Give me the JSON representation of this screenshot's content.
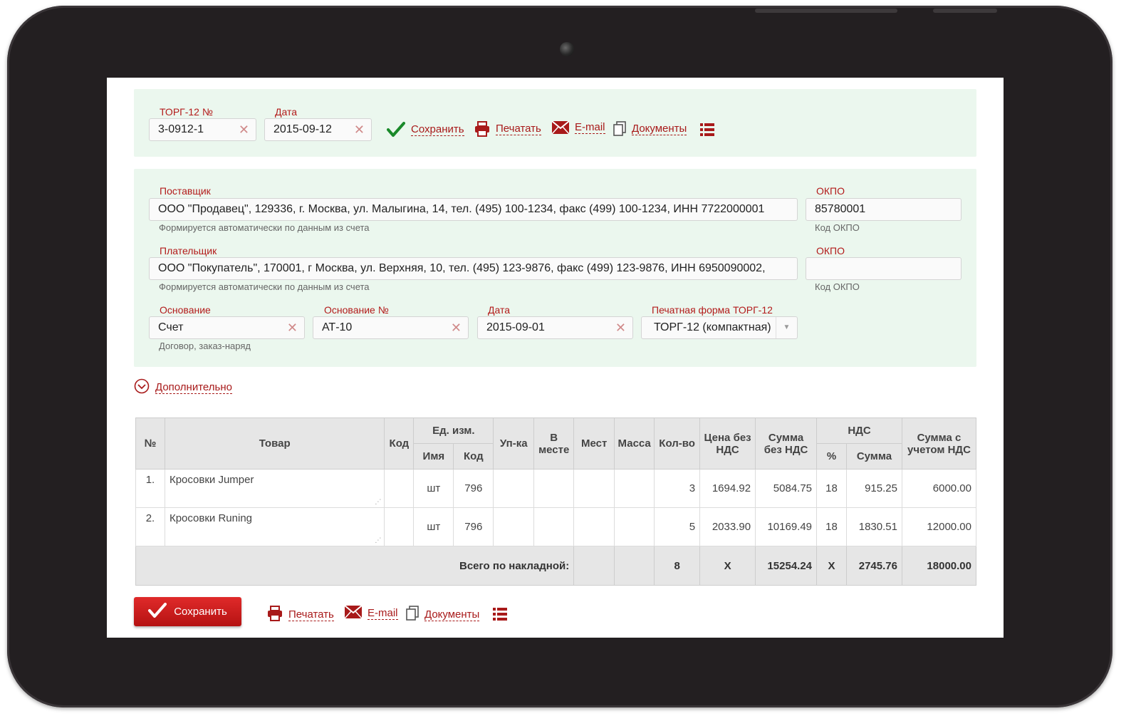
{
  "header": {
    "doc_number_label": "ТОРГ-12 №",
    "doc_number_value": "3-0912-1",
    "date_label": "Дата",
    "date_value": "2015-09-12",
    "save_link": "Сохранить",
    "print_link": "Печатать",
    "email_link": "E-mail",
    "docs_link": "Документы"
  },
  "supplier": {
    "label": "Поставщик",
    "value": "ООО \"Продавец\", 129336, г. Москва, ул. Малыгина, 14, тел. (495) 100-1234, факс (499) 100-1234, ИНН 7722000001",
    "hint": "Формируется автоматически по данным из счета",
    "okpo_label": "ОКПО",
    "okpo_value": "85780001",
    "okpo_hint": "Код ОКПО"
  },
  "payer": {
    "label": "Плательщик",
    "value": "ООО \"Покупатель\", 170001, г Москва, ул. Верхняя, 10, тел. (495) 123-9876, факс (499) 123-9876, ИНН 6950090002,",
    "hint": "Формируется автоматически по данным из счета",
    "okpo_label": "ОКПО",
    "okpo_value": "",
    "okpo_hint": "Код ОКПО"
  },
  "basis": {
    "label": "Основание",
    "value": "Счет",
    "hint": "Договор, заказ-наряд",
    "number_label": "Основание №",
    "number_value": "АТ-10",
    "date_label": "Дата",
    "date_value": "2015-09-01",
    "print_form_label": "Печатная форма ТОРГ-12",
    "print_form_value": "ТОРГ-12 (компактная)"
  },
  "more_link": "Дополнительно",
  "table": {
    "headers": {
      "no": "№",
      "product": "Товар",
      "code": "Код",
      "unit": "Ед. изм.",
      "unit_name": "Имя",
      "unit_code": "Код",
      "pack": "Уп-ка",
      "in_place_1": "В",
      "in_place_2": "месте",
      "places": "Мест",
      "mass": "Масса",
      "qty": "Кол-во",
      "price_1": "Цена без",
      "price_2": "НДС",
      "sum_1": "Сумма",
      "sum_2": "без НДС",
      "vat": "НДС",
      "vat_pct": "%",
      "vat_sum": "Сумма",
      "total_1": "Сумма с",
      "total_2": "учетом НДС"
    },
    "rows": [
      {
        "no": "1.",
        "product": "Кросовки Jumper",
        "code": "",
        "unit_name": "шт",
        "unit_code": "796",
        "pack": "",
        "in_place": "",
        "places": "",
        "mass": "",
        "qty": "3",
        "price": "1694.92",
        "sum": "5084.75",
        "vat_pct": "18",
        "vat_sum": "915.25",
        "total": "6000.00"
      },
      {
        "no": "2.",
        "product": "Кросовки Runing",
        "code": "",
        "unit_name": "шт",
        "unit_code": "796",
        "pack": "",
        "in_place": "",
        "places": "",
        "mass": "",
        "qty": "5",
        "price": "2033.90",
        "sum": "10169.49",
        "vat_pct": "18",
        "vat_sum": "1830.51",
        "total": "12000.00"
      }
    ],
    "totals": {
      "label": "Всего по накладной:",
      "qty": "8",
      "price": "X",
      "sum": "15254.24",
      "vat_pct": "X",
      "vat_sum": "2745.76",
      "total": "18000.00"
    }
  },
  "footer": {
    "save_button": "Сохранить",
    "print_link": "Печатать",
    "email_link": "E-mail",
    "docs_link": "Документы"
  },
  "colors": {
    "accent": "#a81a1a",
    "panel_bg": "#ebf7ee",
    "save_button_bg": "#c81d1d",
    "check_green": "#1a8a2a"
  }
}
